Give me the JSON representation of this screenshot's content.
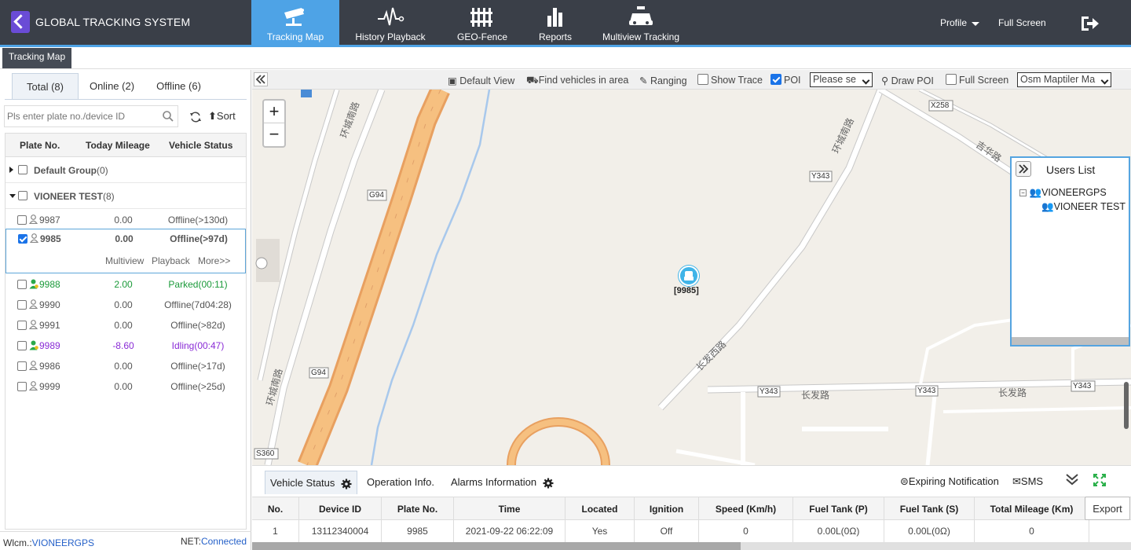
{
  "header": {
    "brand": "GLOBAL TRACKING SYSTEM",
    "nav": [
      {
        "label": "Tracking Map",
        "icon": "camera-icon",
        "active": true
      },
      {
        "label": "History Playback",
        "icon": "pulse-icon",
        "active": false
      },
      {
        "label": "GEO-Fence",
        "icon": "fence-icon",
        "active": false
      },
      {
        "label": "Reports",
        "icon": "bar-chart-icon",
        "active": false
      },
      {
        "label": "Multiview Tracking",
        "icon": "car-icon",
        "active": false
      }
    ],
    "profile": "Profile",
    "fullscreen": "Full Screen",
    "logout_icon": "logout-icon",
    "accent": "#4ea3e6",
    "bg": "#3a3f48"
  },
  "page_tab": "Tracking Map",
  "left": {
    "tabs": [
      {
        "label": "Total (8)",
        "active": true
      },
      {
        "label": "Online (2)",
        "active": false
      },
      {
        "label": "Offline (6)",
        "active": false
      }
    ],
    "search_placeholder": "Pls enter plate no./device ID",
    "sort_label": "Sort",
    "columns": [
      "Plate No.",
      "Today Mileage",
      "Vehicle Status"
    ],
    "groups": [
      {
        "name": "Default Group",
        "count": "(0)"
      },
      {
        "name": "VIONEER TEST",
        "count": "(8)"
      }
    ],
    "vehicles": [
      {
        "plate": "9987",
        "mileage": "0.00",
        "status": "Offline(>130d)"
      },
      {
        "plate": "9985",
        "mileage": "0.00",
        "status": "Offline(>97d)"
      },
      {
        "plate": "9988",
        "mileage": "2.00",
        "status": "Parked(00:11)"
      },
      {
        "plate": "9990",
        "mileage": "0.00",
        "status": "Offline(7d04:28)"
      },
      {
        "plate": "9991",
        "mileage": "0.00",
        "status": "Offline(>82d)"
      },
      {
        "plate": "9989",
        "mileage": "-8.60",
        "status": "Idling(00:47)"
      },
      {
        "plate": "9986",
        "mileage": "0.00",
        "status": "Offline(>17d)"
      },
      {
        "plate": "9999",
        "mileage": "0.00",
        "status": "Offline(>25d)"
      }
    ],
    "selected_actions": [
      "Multiview",
      "Playback",
      "More>>"
    ],
    "footer_welcome_prefix": "Wlcm.:",
    "footer_user": "VIONEERGPS",
    "footer_net_prefix": "NET:",
    "footer_net_status": "Connected"
  },
  "map_toolbar": {
    "default_view": "Default View",
    "find_vehicles": "Find vehicles in area",
    "ranging": "Ranging",
    "show_trace": "Show Trace",
    "poi": "POI",
    "poi_select": "Please se",
    "draw_poi": "Draw POI",
    "full_screen": "Full Screen",
    "map_select": "Osm Maptiler Ma"
  },
  "map": {
    "marker_label": "[9985]",
    "road_labels": [
      "G94",
      "G94",
      "S360",
      "X258",
      "Y343",
      "Y343",
      "Y343",
      "Y343",
      "长发路",
      "长发路",
      "长发西路",
      "吉华路",
      "环城南路",
      "环城南路",
      "环城南路"
    ],
    "zoom_in": "+",
    "zoom_out": "−"
  },
  "users_list": {
    "title": "Users List",
    "root": "VIONEERGPS",
    "child": "VIONEER TEST"
  },
  "bottom": {
    "tabs": [
      {
        "label": "Vehicle Status",
        "active": true
      },
      {
        "label": "Operation Info.",
        "active": false
      },
      {
        "label": "Alarms Information",
        "active": false
      }
    ],
    "expiring": "Expiring Notification",
    "sms": "SMS",
    "export": "Export",
    "columns": [
      "No.",
      "Device ID",
      "Plate No.",
      "Time",
      "Located",
      "Ignition",
      "Speed (Km/h)",
      "Fuel Tank (P)",
      "Fuel Tank (S)",
      "Total Mileage (Km)"
    ],
    "rows": [
      [
        "1",
        "13112340004",
        "9985",
        "2021-09-22 06:22:09",
        "Yes",
        "Off",
        "0",
        "0.00L(0Ω)",
        "0.00L(0Ω)",
        "0"
      ]
    ]
  }
}
